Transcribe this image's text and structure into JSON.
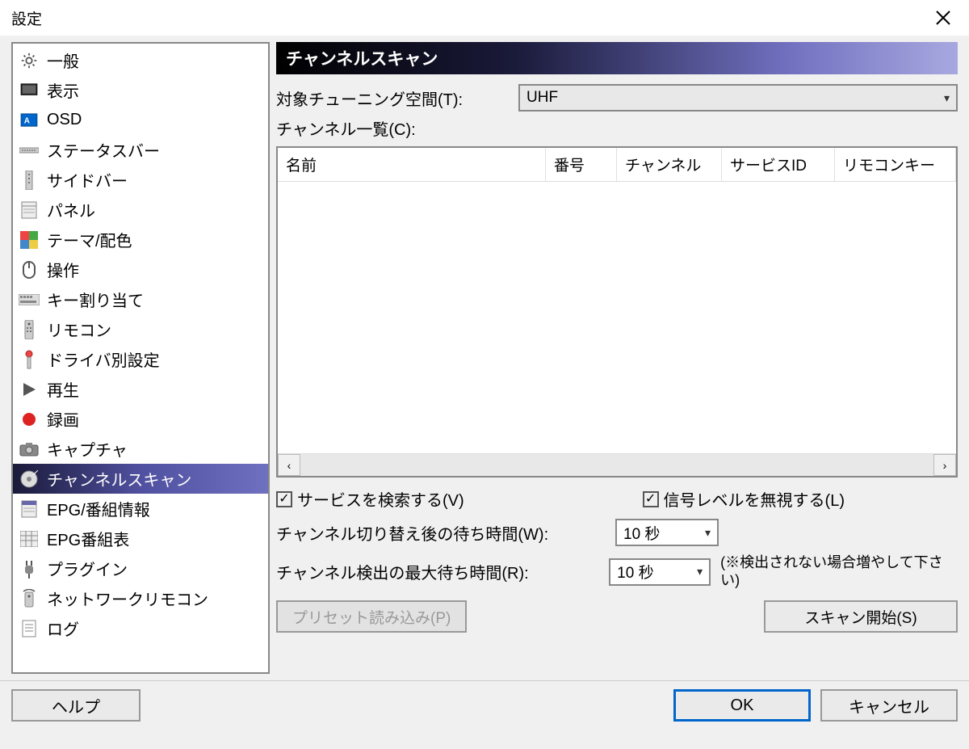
{
  "window": {
    "title": "設定"
  },
  "sidebar": {
    "items": [
      {
        "label": "一般",
        "icon": "gear-icon"
      },
      {
        "label": "表示",
        "icon": "monitor-icon"
      },
      {
        "label": "OSD",
        "icon": "osd-icon"
      },
      {
        "label": "ステータスバー",
        "icon": "statusbar-icon"
      },
      {
        "label": "サイドバー",
        "icon": "sidebar-icon"
      },
      {
        "label": "パネル",
        "icon": "panel-icon"
      },
      {
        "label": "テーマ/配色",
        "icon": "theme-icon"
      },
      {
        "label": "操作",
        "icon": "mouse-icon"
      },
      {
        "label": "キー割り当て",
        "icon": "keyboard-icon"
      },
      {
        "label": "リモコン",
        "icon": "remote-icon"
      },
      {
        "label": "ドライバ別設定",
        "icon": "driver-icon"
      },
      {
        "label": "再生",
        "icon": "play-icon"
      },
      {
        "label": "録画",
        "icon": "record-icon"
      },
      {
        "label": "キャプチャ",
        "icon": "camera-icon"
      },
      {
        "label": "チャンネルスキャン",
        "icon": "disc-icon",
        "selected": true
      },
      {
        "label": "EPG/番組情報",
        "icon": "epg-icon"
      },
      {
        "label": "EPG番組表",
        "icon": "epgtable-icon"
      },
      {
        "label": "プラグイン",
        "icon": "plug-icon"
      },
      {
        "label": "ネットワークリモコン",
        "icon": "netremote-icon"
      },
      {
        "label": "ログ",
        "icon": "log-icon"
      }
    ]
  },
  "content": {
    "header": "チャンネルスキャン",
    "tuning_space_label": "対象チューニング空間(T):",
    "tuning_space_value": "UHF",
    "channel_list_label": "チャンネル一覧(C):",
    "columns": {
      "name": "名前",
      "number": "番号",
      "channel": "チャンネル",
      "service_id": "サービスID",
      "remote_key": "リモコンキー"
    },
    "search_service_label": "サービスを検索する(V)",
    "ignore_signal_label": "信号レベルを無視する(L)",
    "wait_after_switch_label": "チャンネル切り替え後の待ち時間(W):",
    "wait_after_switch_value": "10 秒",
    "detect_max_wait_label": "チャンネル検出の最大待ち時間(R):",
    "detect_max_wait_value": "10 秒",
    "detect_note": "(※検出されない場合増やして下さい)",
    "preset_load_label": "プリセット読み込み(P)",
    "scan_start_label": "スキャン開始(S)"
  },
  "footer": {
    "help": "ヘルプ",
    "ok": "OK",
    "cancel": "キャンセル"
  }
}
